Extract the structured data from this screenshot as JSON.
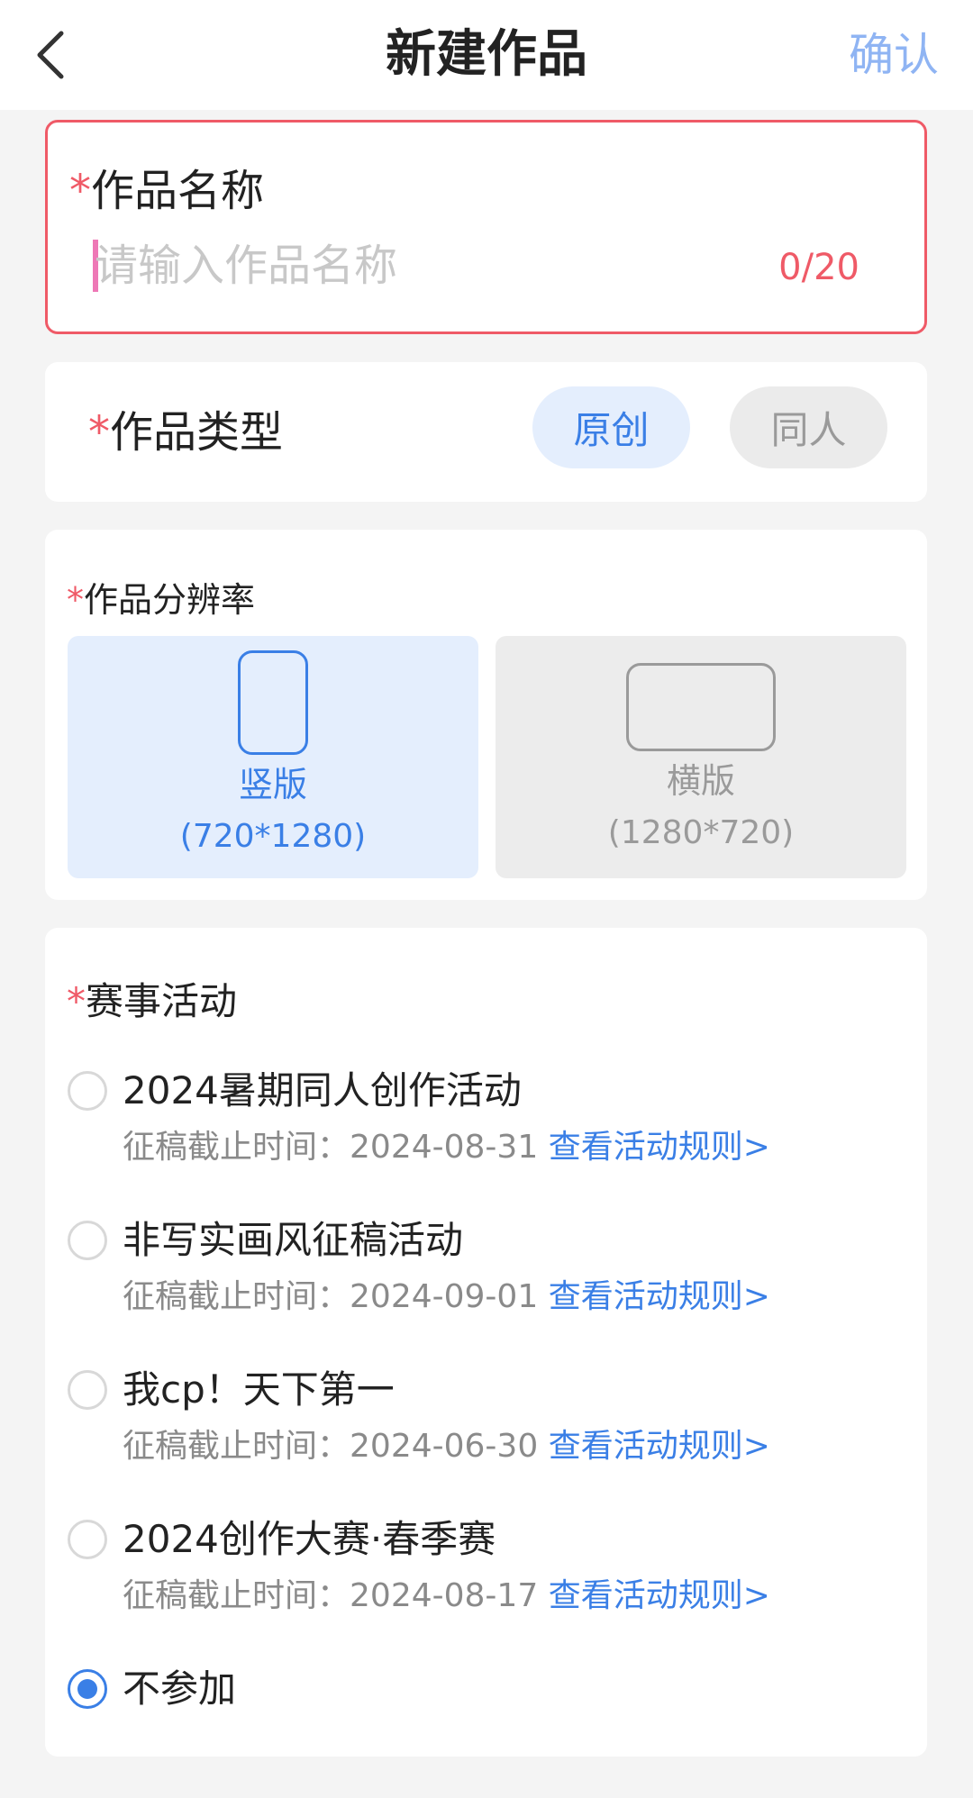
{
  "header": {
    "title": "新建作品",
    "confirm_label": "确认"
  },
  "name_field": {
    "required_mark": "*",
    "label": "作品名称",
    "placeholder": "请输入作品名称",
    "value": "",
    "counter": "0/20"
  },
  "type_field": {
    "required_mark": "*",
    "label": "作品类型",
    "options": [
      "原创",
      "同人"
    ],
    "selected": "原创"
  },
  "resolution_field": {
    "required_mark": "*",
    "label": "作品分辨率",
    "options": [
      {
        "name": "竖版",
        "size": "(720*1280)"
      },
      {
        "name": "横版",
        "size": "(1280*720)"
      }
    ],
    "selected": "竖版"
  },
  "events_field": {
    "required_mark": "*",
    "label": "赛事活动",
    "items": [
      {
        "title": "2024暑期同人创作活动",
        "deadline_label": "征稿截止时间：",
        "deadline": "2024-08-31",
        "rules_link": "查看活动规则>",
        "checked": false
      },
      {
        "title": "非写实画风征稿活动",
        "deadline_label": "征稿截止时间：",
        "deadline": "2024-09-01",
        "rules_link": "查看活动规则>",
        "checked": false
      },
      {
        "title": "我cp！天下第一",
        "deadline_label": "征稿截止时间：",
        "deadline": "2024-06-30",
        "rules_link": "查看活动规则>",
        "checked": false
      },
      {
        "title": "2024创作大赛·春季赛",
        "deadline_label": "征稿截止时间：",
        "deadline": "2024-08-17",
        "rules_link": "查看活动规则>",
        "checked": false
      },
      {
        "title": "不参加",
        "checked": true
      }
    ]
  },
  "colors": {
    "accent": "#3a7fe6",
    "required": "#ef5a67",
    "confirm": "#8fb4f3"
  }
}
